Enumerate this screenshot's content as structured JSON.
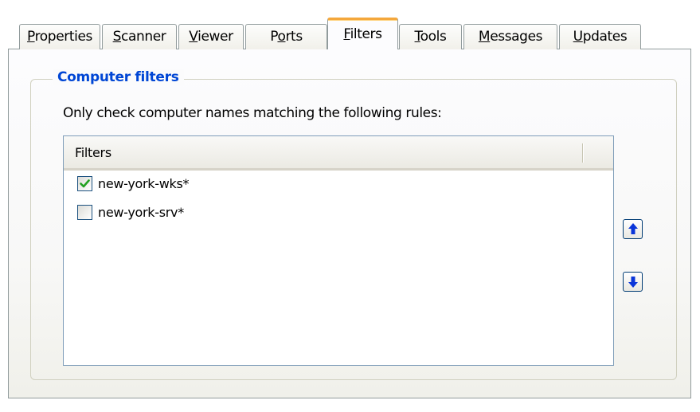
{
  "tabs": [
    {
      "label": "Properties",
      "underline": "P",
      "rest": "roperties",
      "active": false
    },
    {
      "label": "Scanner",
      "underline": "S",
      "rest": "canner",
      "active": false
    },
    {
      "label": "Viewer",
      "underline": "V",
      "rest": "iewer",
      "active": false
    },
    {
      "label": "Ports",
      "pre": "P",
      "underline": "o",
      "rest": "rts",
      "active": false
    },
    {
      "label": "Filters",
      "underline": "F",
      "rest": "ilters",
      "active": true
    },
    {
      "label": "Tools",
      "underline": "T",
      "rest": "ools",
      "active": false
    },
    {
      "label": "Messages",
      "underline": "M",
      "rest": "essages",
      "active": false
    },
    {
      "label": "Updates",
      "underline": "U",
      "rest": "pdates",
      "active": false
    }
  ],
  "group": {
    "title": "Computer filters",
    "description": "Only check computer names matching the following rules:"
  },
  "list": {
    "column_header": "Filters",
    "rows": [
      {
        "text": "new-york-wks*",
        "checked": true
      },
      {
        "text": "new-york-srv*",
        "checked": false
      }
    ]
  },
  "buttons": {
    "move_up_icon": "arrow-up-icon",
    "move_down_icon": "arrow-down-icon"
  },
  "colors": {
    "accent_title": "#0046d5",
    "active_tab_highlight": "#f4a73c",
    "check_green": "#21a121",
    "arrow_blue": "#0a35d9"
  }
}
